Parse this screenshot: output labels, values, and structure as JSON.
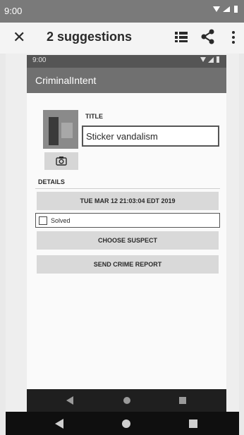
{
  "status_bar": {
    "time": "9:00"
  },
  "topbar": {
    "close_glyph": "✕",
    "title": "2 suggestions",
    "icons": [
      "close-icon",
      "list-icon",
      "share-icon",
      "more-vert-icon"
    ]
  },
  "app": {
    "status_time": "9:00",
    "title": "CriminalIntent",
    "photo_icon": "crime-photo",
    "camera_icon": "camera-icon",
    "title_label": "TITLE",
    "title_value": "Sticker vandalism",
    "details_label": "DETAILS",
    "date_button": "TUE MAR 12 21:03:04 EDT 2019",
    "solved_label": "Solved",
    "solved_checked": false,
    "suspect_button": "CHOOSE SUSPECT",
    "report_button": "SEND CRIME REPORT"
  },
  "nav": {
    "icons": [
      "back-icon",
      "home-icon",
      "recents-icon"
    ]
  },
  "colors": {
    "status_bar": "#7a7a7a",
    "app_bar": "#707070",
    "button": "#d9d9d9",
    "nav_bar": "#0f0f0f"
  }
}
